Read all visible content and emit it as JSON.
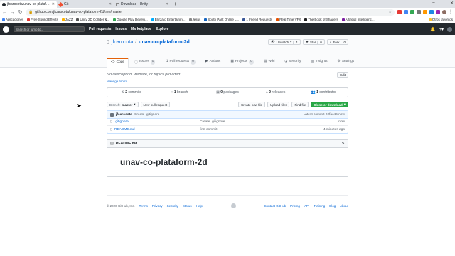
{
  "browser": {
    "tabs": [
      {
        "title": "jfcarocota/unav-co-plataform-2d",
        "active": true,
        "icon_color": "#24292e"
      },
      {
        "title": "Git",
        "active": false,
        "icon_color": "#f05032"
      },
      {
        "title": "Download - Unity",
        "active": false,
        "icon_color": "#888888"
      }
    ],
    "address": "github.com/jfcarocota/unav-co-plataform-2d/tree/master",
    "bookmarks": [
      "Aplicaciones",
      "Free Sound Effects",
      "JAZZ",
      "Unity 2D Collider &...",
      "Google Play Develo...",
      "Blizzard Entertainm...",
      "Jesús",
      "South Park Online L...",
      "1 Friend Requests",
      "Real Time VFX",
      "The Book of Shaders",
      "Artificial Intelligenc..."
    ],
    "bookmarks_more": "Otros favoritos"
  },
  "gh": {
    "search_placeholder": "Search or jump to...",
    "nav": [
      "Pull requests",
      "Issues",
      "Marketplace",
      "Explore"
    ]
  },
  "repo": {
    "owner": "jfcarocota",
    "name": "unav-co-plataform-2d",
    "unwatch": "Unwatch",
    "unwatch_count": "1",
    "star": "Star",
    "star_count": "0",
    "fork": "Fork",
    "fork_count": "0",
    "tabs": [
      {
        "label": "Code",
        "count": ""
      },
      {
        "label": "Issues",
        "count": "0"
      },
      {
        "label": "Pull requests",
        "count": "0"
      },
      {
        "label": "Actions",
        "count": ""
      },
      {
        "label": "Projects",
        "count": "0"
      },
      {
        "label": "Wiki",
        "count": ""
      },
      {
        "label": "Security",
        "count": ""
      },
      {
        "label": "Insights",
        "count": ""
      },
      {
        "label": "Settings",
        "count": ""
      }
    ],
    "description": "No description, website, or topics provided.",
    "edit": "Edit",
    "manage_topics": "Manage topics",
    "summary": [
      {
        "count": "2",
        "label": "commits"
      },
      {
        "count": "1",
        "label": "branch"
      },
      {
        "count": "0",
        "label": "packages"
      },
      {
        "count": "0",
        "label": "releases"
      },
      {
        "count": "1",
        "label": "contributor"
      }
    ],
    "branch_label": "Branch:",
    "branch": "master",
    "new_pr": "New pull request",
    "create_file": "Create new file",
    "upload": "Upload files",
    "find": "Find file",
    "clone": "Clone or download",
    "commit_author": "jfcarocota",
    "commit_msg": "Create .gitignore",
    "commit_meta": "Latest commit 22fac46 now",
    "files": [
      {
        "name": ".gitignore",
        "msg": "Create .gitignore",
        "time": "now"
      },
      {
        "name": "README.md",
        "msg": "first commit",
        "time": "4 minutes ago"
      }
    ],
    "readme_title": "README.md",
    "readme_h1": "unav-co-plataform-2d"
  },
  "footer": {
    "copyright": "© 2020 GitHub, Inc.",
    "left": [
      "Terms",
      "Privacy",
      "Security",
      "Status",
      "Help"
    ],
    "right": [
      "Contact GitHub",
      "Pricing",
      "API",
      "Training",
      "Blog",
      "About"
    ]
  }
}
